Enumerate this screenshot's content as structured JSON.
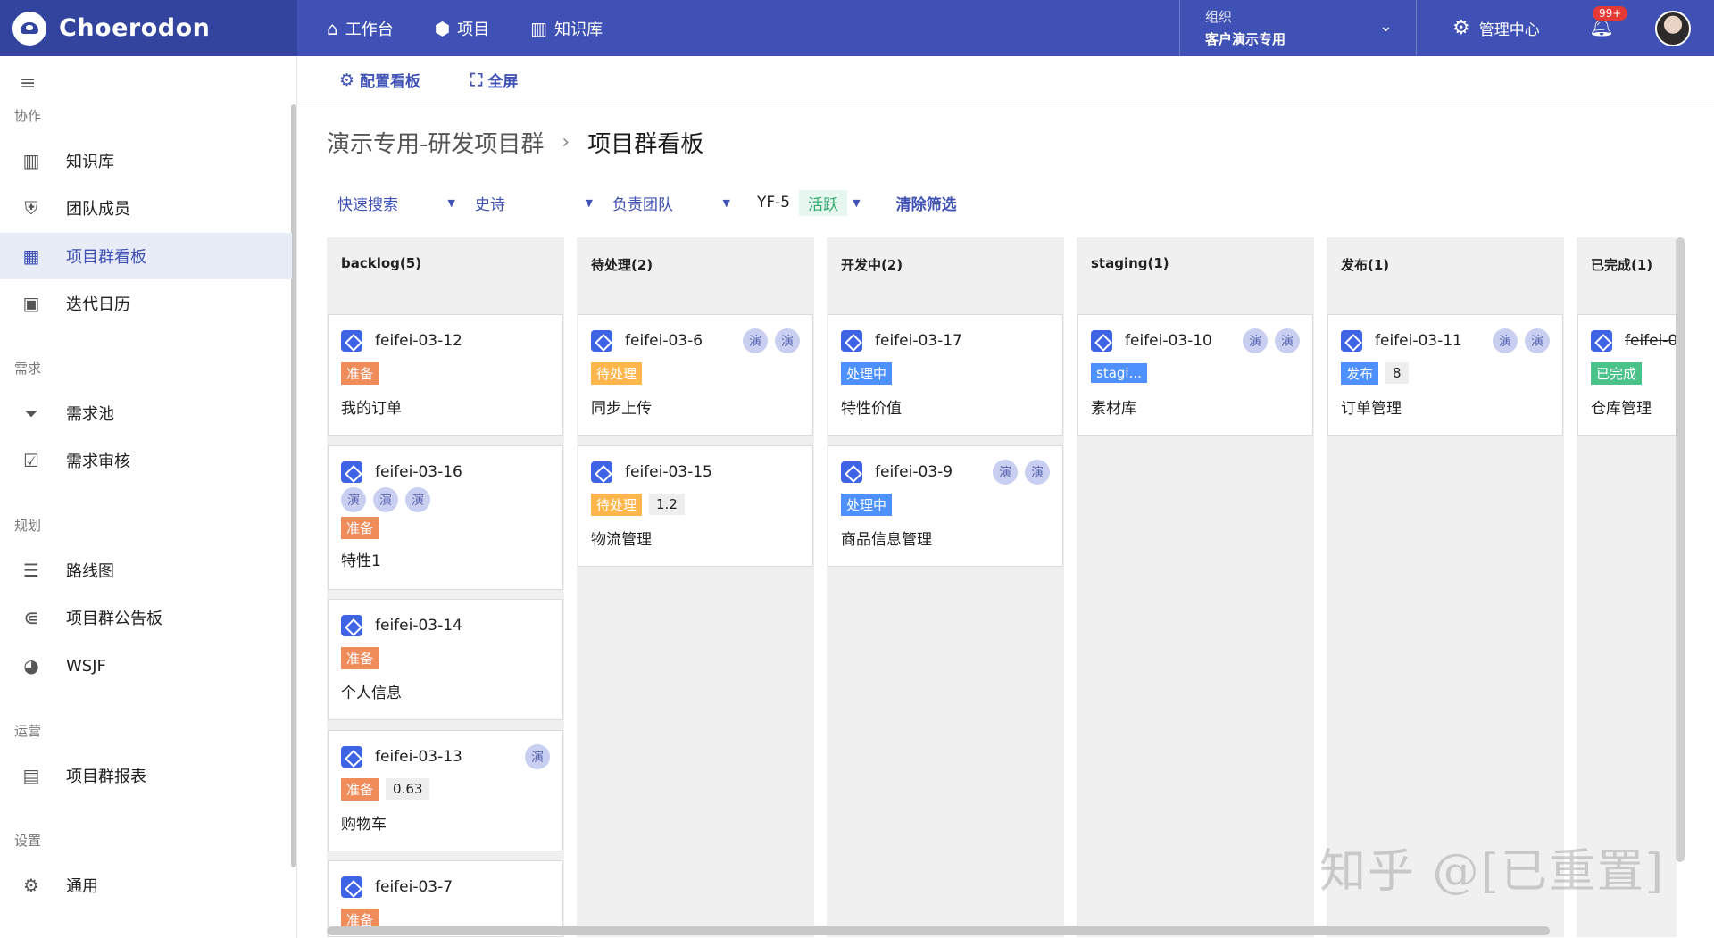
{
  "app": {
    "logo_text": "Choerodon"
  },
  "topnav": {
    "items": [
      {
        "label": "工作台",
        "icon": "home-icon"
      },
      {
        "label": "项目",
        "icon": "box-icon"
      },
      {
        "label": "知识库",
        "icon": "book-icon"
      }
    ],
    "org_label": "组织",
    "org_value": "客户演示专用",
    "manage_label": "管理中心",
    "notification_badge": "99+"
  },
  "sidebar": {
    "sections": [
      {
        "title": "协作",
        "items": [
          "知识库",
          "团队成员",
          "项目群看板",
          "迭代日历"
        ]
      },
      {
        "title": "需求",
        "items": [
          "需求池",
          "需求审核"
        ]
      },
      {
        "title": "规划",
        "items": [
          "路线图",
          "项目群公告板",
          "WSJF"
        ]
      },
      {
        "title": "运营",
        "items": [
          "项目群报表"
        ]
      },
      {
        "title": "设置",
        "items": [
          "通用"
        ]
      }
    ],
    "active": "项目群看板"
  },
  "toolbar": {
    "config_label": "配置看板",
    "fullscreen_label": "全屏"
  },
  "breadcrumb": {
    "parent": "演示专用-研发项目群",
    "separator": "›",
    "current": "项目群看板"
  },
  "filters": {
    "quick_search": "快速搜索",
    "epic": "史诗",
    "team": "负责团队",
    "sprint_name": "YF-5",
    "sprint_status": "活跃",
    "clear": "清除筛选"
  },
  "board": {
    "columns": [
      {
        "title": "backlog(5)",
        "cards": [
          {
            "num": "feifei-03-12",
            "tag": "准备",
            "title": "我的订单"
          },
          {
            "num": "feifei-03-16",
            "avatars": [
              "演",
              "演",
              "演"
            ],
            "tag": "准备",
            "title": "特性1"
          },
          {
            "num": "feifei-03-14",
            "tag": "准备",
            "title": "个人信息"
          },
          {
            "num": "feifei-03-13",
            "avatar": "演",
            "tag": "准备",
            "sp": "0.63",
            "title": "购物车"
          },
          {
            "num": "feifei-03-7",
            "tag": "准备"
          }
        ]
      },
      {
        "title": "待处理(2)",
        "cards": [
          {
            "num": "feifei-03-6",
            "avatars": [
              "演",
              "演"
            ],
            "tag": "待处理",
            "title": "同步上传"
          },
          {
            "num": "feifei-03-15",
            "tag": "待处理",
            "sp": "1.2",
            "title": "物流管理"
          }
        ]
      },
      {
        "title": "开发中(2)",
        "cards": [
          {
            "num": "feifei-03-17",
            "tag": "处理中",
            "title": "特性价值"
          },
          {
            "num": "feifei-03-9",
            "avatars": [
              "演",
              "演"
            ],
            "tag": "处理中",
            "title": "商品信息管理"
          }
        ]
      },
      {
        "title": "staging(1)",
        "cards": [
          {
            "num": "feifei-03-10",
            "avatars": [
              "演",
              "演"
            ],
            "tag": "stagi...",
            "title": "素材库"
          }
        ]
      },
      {
        "title": "发布(1)",
        "cards": [
          {
            "num": "feifei-03-11",
            "avatars": [
              "演",
              "演"
            ],
            "tag": "发布",
            "sp": "8",
            "title": "订单管理"
          }
        ]
      },
      {
        "title": "已完成(1)",
        "cards": [
          {
            "num": "feifei-0",
            "tag": "已完成",
            "title": "仓库管理"
          }
        ]
      }
    ]
  },
  "watermark": "知乎 @[已重置]"
}
